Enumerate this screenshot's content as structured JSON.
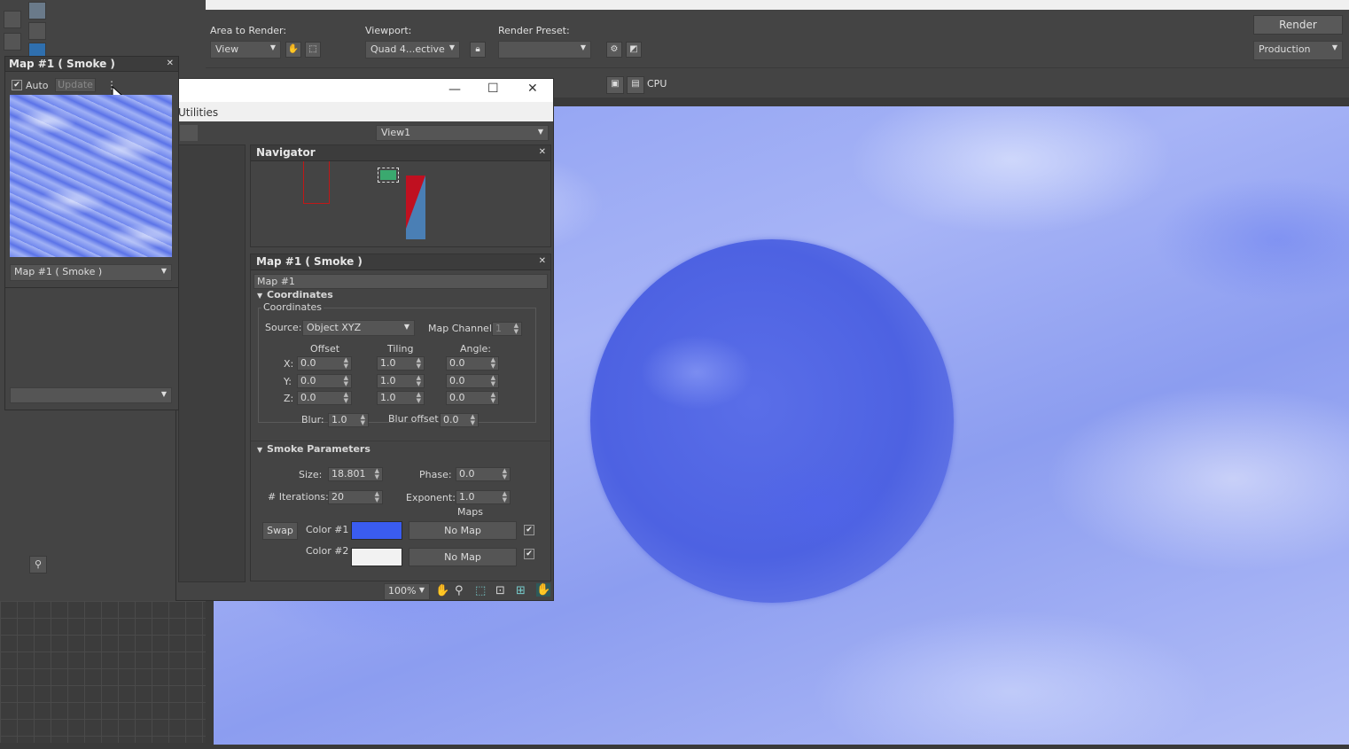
{
  "render_frame": {
    "area_to_render_label": "Area to Render:",
    "area_to_render_value": "View",
    "viewport_label": "Viewport:",
    "viewport_value": "Quad 4...ective",
    "render_preset_label": "Render Preset:",
    "render_preset_value": "",
    "render_button": "Render",
    "production_value": "Production",
    "cpu_label": "CPU"
  },
  "slate": {
    "menu_partial": "Utilities",
    "view_dropdown": "View1",
    "navigator_title": "Navigator",
    "param_title": "Map #1  ( Smoke )",
    "map_name": "Map #1",
    "zoom": "100%",
    "coordinates": {
      "rollout_title": "Coordinates",
      "group_title": "Coordinates",
      "source_label": "Source:",
      "source_value": "Object XYZ",
      "map_channel_label": "Map Channel:",
      "map_channel_value": "1",
      "offset_label": "Offset",
      "tiling_label": "Tiling",
      "angle_label": "Angle:",
      "rows": [
        {
          "axis": "X:",
          "offset": "0.0",
          "tiling": "1.0",
          "angle": "0.0"
        },
        {
          "axis": "Y:",
          "offset": "0.0",
          "tiling": "1.0",
          "angle": "0.0"
        },
        {
          "axis": "Z:",
          "offset": "0.0",
          "tiling": "1.0",
          "angle": "0.0"
        }
      ],
      "blur_label": "Blur:",
      "blur_value": "1.0",
      "blur_offset_label": "Blur offset:",
      "blur_offset_value": "0.0"
    },
    "smoke": {
      "rollout_title": "Smoke Parameters",
      "size_label": "Size:",
      "size_value": "18.801",
      "phase_label": "Phase:",
      "phase_value": "0.0",
      "iterations_label": "# Iterations:",
      "iterations_value": "20",
      "exponent_label": "Exponent:",
      "exponent_value": "1.0",
      "maps_label": "Maps",
      "swap_label": "Swap",
      "color1_label": "Color #1",
      "color2_label": "Color #2",
      "color1": "#3a5cf0",
      "color2": "#f2f2f2",
      "no_map_1": "No Map",
      "no_map_2": "No Map"
    }
  },
  "material_window": {
    "title": "Map #1  ( Smoke )",
    "auto_label": "Auto",
    "update_label": "Update",
    "material_dropdown": "Map #1  ( Smoke )",
    "second_dropdown": ""
  }
}
